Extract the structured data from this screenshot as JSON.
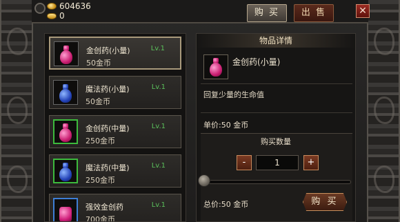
{
  "currency": {
    "gold": "604636",
    "ingot": "0"
  },
  "tabs": {
    "buy": "购 买",
    "sell": "出 售"
  },
  "close": "✕",
  "items": [
    {
      "name": "金创药(小量)",
      "level": "Lv.1",
      "price": "50金币",
      "potion": "red",
      "slot": "plain",
      "selected": true
    },
    {
      "name": "魔法药(小量)",
      "level": "Lv.1",
      "price": "50金币",
      "potion": "blue",
      "slot": "plain",
      "selected": false
    },
    {
      "name": "金创药(中量)",
      "level": "Lv.1",
      "price": "250金币",
      "potion": "red",
      "slot": "green",
      "selected": false
    },
    {
      "name": "魔法药(中量)",
      "level": "Lv.1",
      "price": "250金币",
      "potion": "blue",
      "slot": "green",
      "selected": false
    },
    {
      "name": "强效金创药",
      "level": "Lv.1",
      "price": "700金币",
      "potion": "red-big",
      "slot": "blue",
      "selected": false
    }
  ],
  "detail": {
    "title": "物品详情",
    "name": "金创药(小量)",
    "description": "回复少量的生命值",
    "unit_price": "单价:50 金币",
    "qty_title": "购买数量",
    "minus": "-",
    "plus": "+",
    "qty": "1",
    "total_price": "总价:50 金币",
    "buy": "购 买"
  },
  "slider_level": 0
}
